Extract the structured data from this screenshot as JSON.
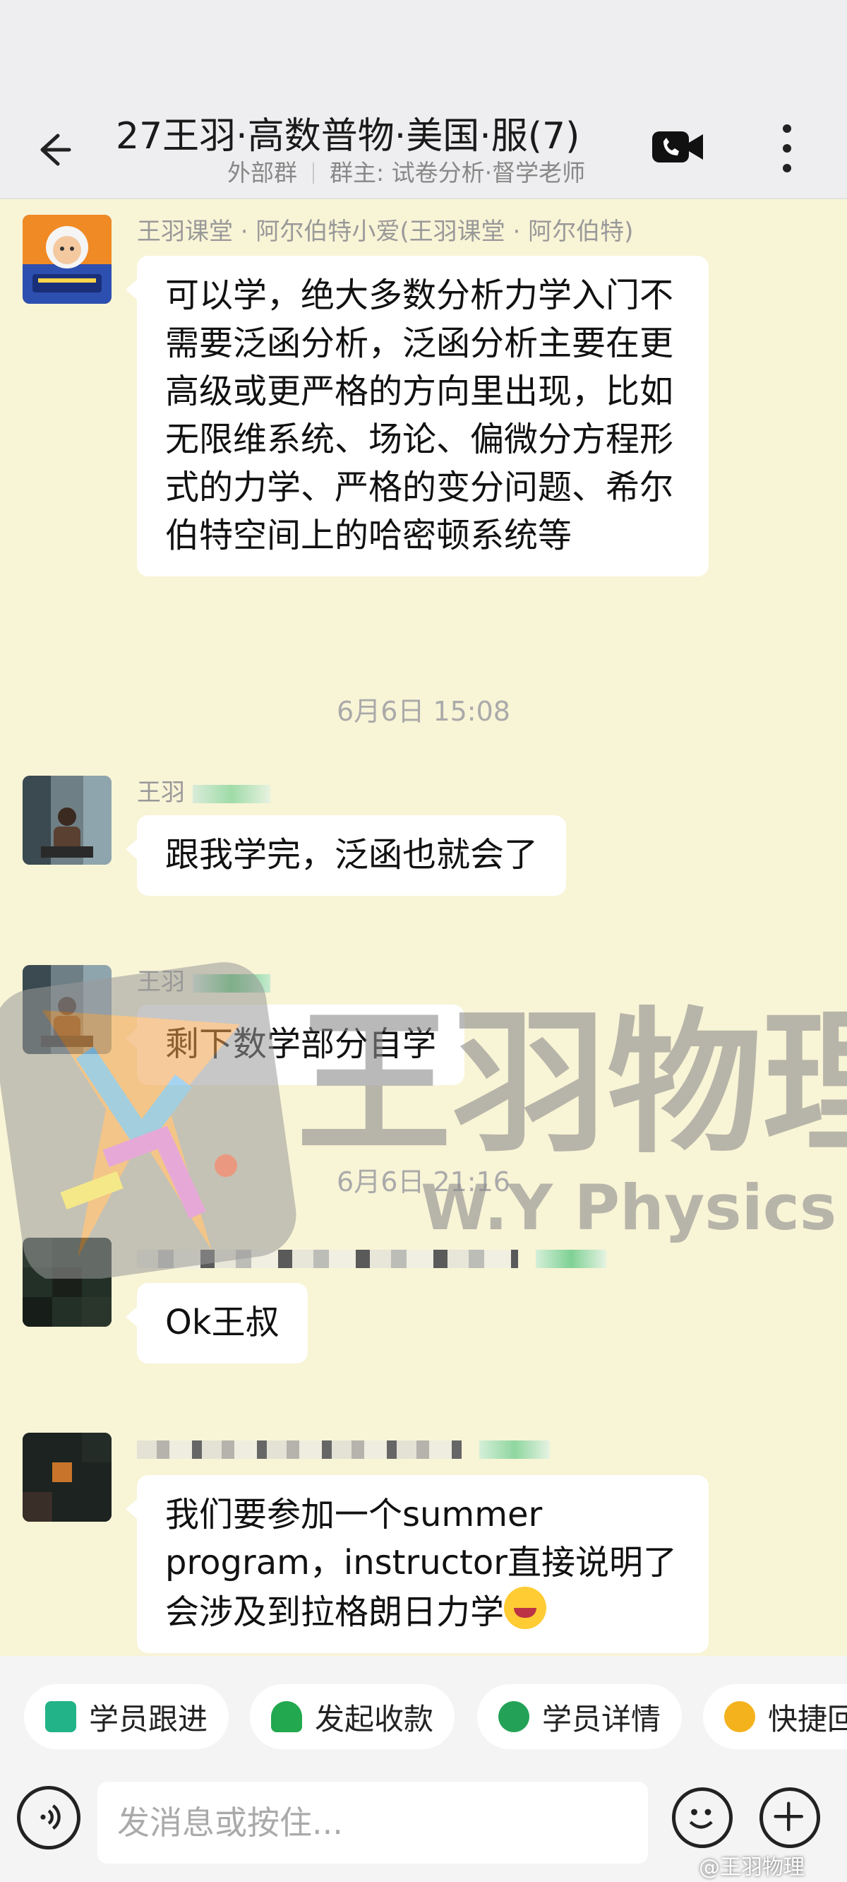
{
  "header": {
    "title": "27王羽·高数普物·美国·服(7)",
    "group_type": "外部群",
    "owner": "群主: 试卷分析·督学老师"
  },
  "messages": [
    {
      "sender": "王羽课堂 · 阿尔伯特小爱(王羽课堂 · 阿尔伯特)",
      "text": "可以学，绝大多数分析力学入门不需要泛函分析，泛函分析主要在更高级或更严格的方向里出现，比如无限维系统、场论、偏微分方程形式的力学、严格的变分问题、希尔伯特空间上的哈密顿系统等"
    },
    {
      "time": "6月6日  15:08"
    },
    {
      "sender": "王羽",
      "text": "跟我学完，泛函也就会了"
    },
    {
      "sender": "王羽",
      "text": "剩下数学部分自学"
    },
    {
      "time": "6月6日  21:16"
    },
    {
      "sender": "",
      "text": "Ok王叔"
    },
    {
      "sender": "",
      "text": "我们要参加一个summer program，instructor直接说明了会涉及到拉格朗日力学"
    }
  ],
  "watermark": {
    "brand": "王羽物理",
    "brand_en": "W.Y  Physics"
  },
  "quick_actions": [
    "学员跟进",
    "发起收款",
    "学员详情",
    "快捷回"
  ],
  "input": {
    "placeholder": "发消息或按住..."
  },
  "credit": "@王羽物理",
  "colors": {
    "chat_bg": "#f8f4d6",
    "bubble": "#ffffff",
    "header_bg": "#eeeef0",
    "accent_green": "#20b07a"
  }
}
